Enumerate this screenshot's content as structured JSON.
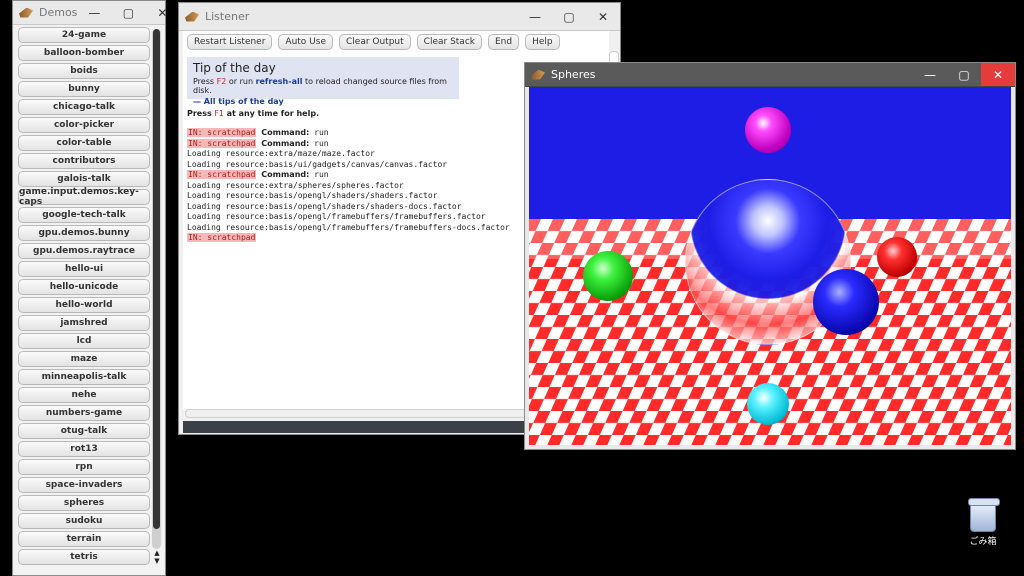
{
  "windows": {
    "demos": {
      "title": "Demos",
      "items": [
        "24-game",
        "balloon-bomber",
        "boids",
        "bunny",
        "chicago-talk",
        "color-picker",
        "color-table",
        "contributors",
        "galois-talk",
        "game.input.demos.key-caps",
        "google-tech-talk",
        "gpu.demos.bunny",
        "gpu.demos.raytrace",
        "hello-ui",
        "hello-unicode",
        "hello-world",
        "jamshred",
        "lcd",
        "maze",
        "minneapolis-talk",
        "nehe",
        "numbers-game",
        "otug-talk",
        "rot13",
        "rpn",
        "space-invaders",
        "spheres",
        "sudoku",
        "terrain",
        "tetris"
      ]
    },
    "listener": {
      "title": "Listener",
      "toolbar": {
        "restart": "Restart Listener",
        "auto_use": "Auto Use",
        "clear_output": "Clear Output",
        "clear_stack": "Clear Stack",
        "end": "End",
        "help": "Help"
      },
      "tip": {
        "title": "Tip of the day",
        "press": "Press",
        "key_f2": "F2",
        "or_run": "or run",
        "refresh_all": "refresh-all",
        "tail": "to reload changed source files from disk.",
        "all_tips": "— All tips of the day"
      },
      "help": {
        "press": "Press",
        "key_f1": "F1",
        "tail": "at any time for help."
      },
      "log": [
        {
          "type": "in",
          "tag": "IN: scratchpad",
          "cmd": "Command:",
          "text": "run"
        },
        {
          "type": "in",
          "tag": "IN: scratchpad",
          "cmd": "Command:",
          "text": "run"
        },
        {
          "type": "text",
          "text": "Loading resource:extra/maze/maze.factor"
        },
        {
          "type": "text",
          "text": "Loading resource:basis/ui/gadgets/canvas/canvas.factor"
        },
        {
          "type": "in",
          "tag": "IN: scratchpad",
          "cmd": "Command:",
          "text": "run"
        },
        {
          "type": "text",
          "text": "Loading resource:extra/spheres/spheres.factor"
        },
        {
          "type": "text",
          "text": "Loading resource:basis/opengl/shaders/shaders.factor"
        },
        {
          "type": "text",
          "text": "Loading resource:basis/opengl/shaders/shaders-docs.factor"
        },
        {
          "type": "text",
          "text": "Loading resource:basis/opengl/framebuffers/framebuffers.factor"
        },
        {
          "type": "text",
          "text": "Loading resource:basis/opengl/framebuffers/framebuffers-docs.factor"
        },
        {
          "type": "in",
          "tag": "IN: scratchpad",
          "cmd": "",
          "text": ""
        }
      ]
    },
    "spheres": {
      "title": "Spheres"
    }
  },
  "desktop": {
    "recycle_bin_label": "ごみ箱"
  },
  "icons": {
    "minimize": "minimize-icon",
    "maximize": "maximize-icon",
    "close": "close-icon"
  },
  "colors": {
    "sky": "#1d1de6",
    "checker_red": "#ff2a2a",
    "checker_white": "#ffffff",
    "in_tag_bg": "#f4b8b8"
  }
}
